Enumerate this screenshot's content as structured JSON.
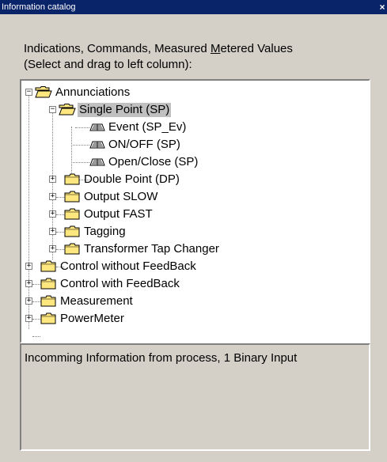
{
  "window": {
    "title": "Information catalog",
    "close_glyph": "×"
  },
  "instructions": {
    "line1_pre": "Indications, Commands, Measured ",
    "line1_underlined": "M",
    "line1_post": "etered Values",
    "line2": "(Select and drag to left column):"
  },
  "tree": {
    "annunciations": "Annunciations",
    "single_point": "Single Point (SP)",
    "event": "Event (SP_Ev)",
    "on_off": "ON/OFF (SP)",
    "open_close": "Open/Close (SP)",
    "double_point": "Double Point (DP)",
    "output_slow": "Output SLOW",
    "output_fast": "Output FAST",
    "tagging": "Tagging",
    "transformer": "Transformer Tap Changer",
    "control_without": "Control without FeedBack",
    "control_with": "Control with FeedBack",
    "measurement": "Measurement",
    "powermeter": "PowerMeter",
    "expand_glyph": "+",
    "collapse_glyph": "−",
    "selected_item": "single_point"
  },
  "description": {
    "text": "Incomming Information from process, 1 Binary Input"
  },
  "colors": {
    "title_bar": "#0a246a",
    "face": "#d4d0c8",
    "folder": "#ffe780",
    "selection": "#c0c0c0"
  },
  "icons": {
    "folder_closed": "folder-icon",
    "folder_open": "folder-open-icon",
    "information": "info-item-icon"
  }
}
